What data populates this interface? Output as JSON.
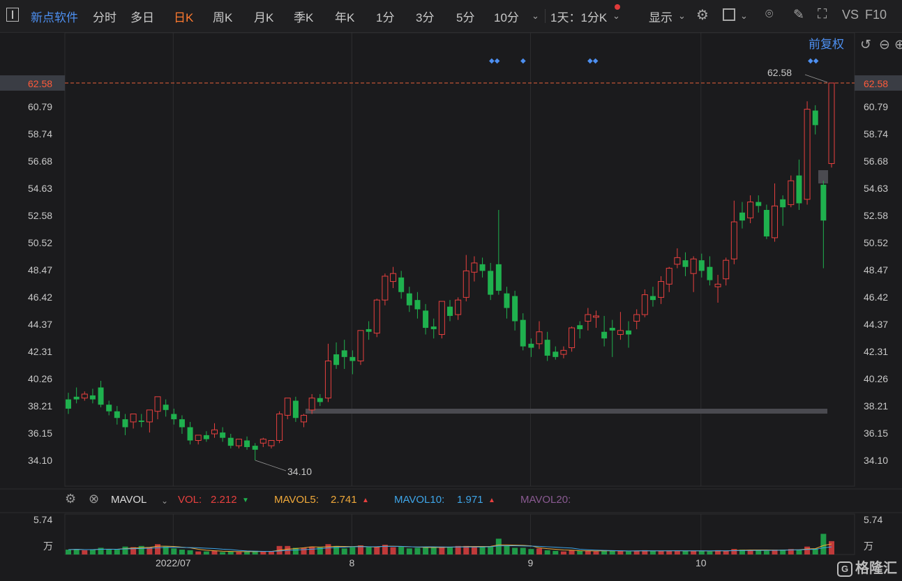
{
  "toolbar": {
    "stock_name": "新点软件",
    "periods": [
      "分时",
      "多日",
      "日K",
      "周K",
      "月K",
      "季K",
      "年K",
      "1分",
      "3分",
      "5分",
      "10分"
    ],
    "active_period": "日K",
    "interval_select": "1天：1分K",
    "display_label": "显示",
    "vs_label": "VS",
    "f10_label": "F10"
  },
  "chart_header": {
    "adjust_label": "前复权"
  },
  "price_axis": {
    "ticks": [
      "60.79",
      "58.74",
      "56.68",
      "54.63",
      "52.58",
      "50.52",
      "48.47",
      "46.42",
      "44.37",
      "42.31",
      "40.26",
      "38.21",
      "36.15",
      "34.10"
    ],
    "current": "62.58"
  },
  "annotations": {
    "high": "62.58",
    "low": "34.10"
  },
  "volume": {
    "indicator": "MAVOL",
    "vol_label": "VOL:",
    "vol_value": "2.212",
    "mavol5_label": "MAVOL5:",
    "mavol5_value": "2.741",
    "mavol10_label": "MAVOL10:",
    "mavol10_value": "1.971",
    "mavol20_label": "MAVOL20:",
    "axis_max": "5.74",
    "axis_unit": "万"
  },
  "x_axis": {
    "labels": [
      "2022/07",
      "8",
      "9",
      "10"
    ]
  },
  "logo": {
    "text": "格隆汇",
    "mark": "G"
  },
  "colors": {
    "up": "#e8403f",
    "down": "#1fb14e",
    "accent": "#ff7a2f",
    "link": "#4d8ff0",
    "ma5": "#f0a93a",
    "ma10": "#3ea5e8",
    "ma20": "#8a5a92"
  },
  "chart_data": {
    "type": "candlestick",
    "ylim": [
      34.1,
      62.58
    ],
    "candles": [
      [
        38.7,
        39.2,
        38.0,
        37.6,
        "down"
      ],
      [
        38.9,
        39.6,
        38.7,
        38.4,
        "down"
      ],
      [
        38.8,
        39.3,
        39.1,
        38.6,
        "up"
      ],
      [
        39.0,
        39.5,
        38.7,
        38.4,
        "down"
      ],
      [
        39.6,
        40.1,
        38.3,
        38.1,
        "down"
      ],
      [
        38.3,
        38.6,
        37.8,
        37.5,
        "down"
      ],
      [
        37.8,
        38.2,
        37.3,
        36.8,
        "down"
      ],
      [
        37.2,
        37.6,
        36.6,
        36.0,
        "down"
      ],
      [
        37.0,
        37.4,
        37.6,
        36.5,
        "up"
      ],
      [
        37.1,
        37.6,
        37.0,
        36.6,
        "down"
      ],
      [
        37.0,
        37.6,
        37.9,
        36.2,
        "up"
      ],
      [
        37.8,
        38.9,
        38.9,
        37.2,
        "up"
      ],
      [
        38.3,
        38.7,
        37.9,
        37.4,
        "down"
      ],
      [
        37.6,
        38.0,
        37.2,
        36.8,
        "down"
      ],
      [
        37.2,
        37.5,
        36.6,
        36.1,
        "down"
      ],
      [
        36.6,
        37.0,
        35.6,
        35.3,
        "down"
      ],
      [
        35.6,
        36.0,
        36.0,
        35.3,
        "up"
      ],
      [
        36.0,
        36.3,
        35.7,
        35.5,
        "down"
      ],
      [
        36.1,
        36.9,
        36.4,
        35.8,
        "up"
      ],
      [
        36.2,
        36.6,
        35.8,
        35.5,
        "down"
      ],
      [
        35.8,
        36.1,
        35.2,
        35.0,
        "down"
      ],
      [
        35.2,
        35.7,
        35.7,
        35.0,
        "up"
      ],
      [
        35.6,
        35.9,
        35.1,
        34.9,
        "down"
      ],
      [
        35.2,
        35.4,
        34.9,
        34.1,
        "down"
      ],
      [
        35.4,
        35.8,
        35.7,
        35.1,
        "up"
      ],
      [
        35.2,
        35.5,
        35.6,
        35.0,
        "up"
      ],
      [
        35.6,
        37.8,
        37.6,
        35.4,
        "up"
      ],
      [
        37.5,
        38.8,
        38.8,
        37.2,
        "up"
      ],
      [
        38.6,
        38.9,
        37.3,
        37.0,
        "down"
      ],
      [
        37.0,
        37.6,
        37.5,
        36.6,
        "up"
      ],
      [
        37.9,
        39.1,
        38.8,
        37.6,
        "up"
      ],
      [
        38.5,
        39.1,
        38.8,
        38.2,
        "down"
      ],
      [
        38.8,
        42.9,
        41.6,
        38.5,
        "up"
      ],
      [
        42.1,
        43.0,
        41.3,
        41.0,
        "down"
      ],
      [
        42.4,
        43.2,
        41.9,
        41.0,
        "down"
      ],
      [
        41.9,
        42.4,
        41.6,
        40.6,
        "down"
      ],
      [
        41.6,
        43.4,
        43.9,
        41.3,
        "up"
      ],
      [
        44.0,
        44.6,
        43.8,
        43.2,
        "down"
      ],
      [
        43.7,
        46.3,
        46.2,
        43.4,
        "up"
      ],
      [
        46.2,
        48.2,
        48.0,
        45.8,
        "up"
      ],
      [
        48.2,
        48.7,
        47.6,
        47.1,
        "up"
      ],
      [
        47.9,
        48.4,
        46.8,
        46.3,
        "down"
      ],
      [
        46.7,
        47.2,
        45.8,
        45.3,
        "down"
      ],
      [
        46.2,
        46.8,
        45.5,
        44.8,
        "down"
      ],
      [
        45.4,
        45.9,
        44.1,
        43.6,
        "down"
      ],
      [
        44.2,
        44.8,
        44.0,
        43.3,
        "down"
      ],
      [
        43.6,
        46.1,
        46.1,
        43.3,
        "up"
      ],
      [
        45.7,
        46.2,
        45.0,
        44.6,
        "down"
      ],
      [
        45.1,
        46.4,
        46.2,
        44.7,
        "up"
      ],
      [
        46.4,
        49.6,
        48.4,
        46.1,
        "up"
      ],
      [
        48.3,
        49.5,
        49.0,
        47.6,
        "up"
      ],
      [
        48.9,
        49.4,
        48.4,
        47.9,
        "down"
      ],
      [
        48.4,
        49.0,
        46.6,
        46.2,
        "down"
      ],
      [
        48.9,
        53.0,
        46.9,
        46.6,
        "down"
      ],
      [
        46.7,
        47.2,
        45.6,
        44.8,
        "down"
      ],
      [
        46.5,
        46.9,
        44.6,
        43.9,
        "down"
      ],
      [
        44.7,
        45.2,
        42.7,
        42.4,
        "down"
      ],
      [
        42.9,
        43.3,
        42.6,
        41.9,
        "down"
      ],
      [
        42.9,
        44.6,
        43.8,
        42.5,
        "up"
      ],
      [
        43.2,
        43.8,
        42.0,
        41.6,
        "down"
      ],
      [
        42.3,
        42.7,
        41.9,
        41.7,
        "down"
      ],
      [
        42.1,
        42.7,
        42.4,
        41.8,
        "up"
      ],
      [
        42.6,
        44.2,
        44.1,
        42.3,
        "up"
      ],
      [
        44.0,
        44.6,
        44.3,
        43.3,
        "down"
      ],
      [
        44.6,
        45.6,
        45.1,
        43.9,
        "up"
      ],
      [
        45.0,
        45.4,
        44.9,
        44.1,
        "up"
      ],
      [
        43.8,
        45.0,
        43.3,
        42.7,
        "down"
      ],
      [
        44.1,
        44.7,
        43.9,
        41.9,
        "down"
      ],
      [
        43.6,
        45.3,
        43.9,
        43.2,
        "up"
      ],
      [
        43.9,
        44.6,
        43.6,
        42.6,
        "down"
      ],
      [
        44.6,
        45.5,
        45.1,
        44.0,
        "up"
      ],
      [
        45.1,
        47.0,
        46.6,
        44.9,
        "up"
      ],
      [
        46.5,
        47.2,
        46.2,
        45.7,
        "down"
      ],
      [
        46.4,
        48.0,
        47.6,
        45.9,
        "up"
      ],
      [
        47.4,
        48.7,
        48.6,
        46.8,
        "up"
      ],
      [
        48.9,
        50.1,
        49.4,
        48.6,
        "up"
      ],
      [
        49.2,
        49.8,
        48.7,
        48.0,
        "down"
      ],
      [
        48.2,
        49.5,
        49.3,
        46.8,
        "up"
      ],
      [
        49.2,
        49.7,
        48.4,
        47.9,
        "down"
      ],
      [
        48.7,
        49.5,
        47.7,
        47.3,
        "down"
      ],
      [
        47.4,
        48.1,
        47.2,
        46.0,
        "up"
      ],
      [
        47.8,
        49.4,
        49.2,
        47.3,
        "up"
      ],
      [
        49.3,
        53.7,
        52.1,
        48.9,
        "up"
      ],
      [
        52.2,
        53.6,
        52.8,
        51.6,
        "down"
      ],
      [
        52.4,
        54.1,
        53.6,
        52.0,
        "up"
      ],
      [
        53.6,
        54.1,
        53.3,
        52.8,
        "down"
      ],
      [
        53.0,
        53.4,
        51.0,
        50.8,
        "down"
      ],
      [
        50.9,
        55.0,
        53.3,
        50.6,
        "up"
      ],
      [
        53.8,
        54.1,
        53.2,
        51.8,
        "down"
      ],
      [
        53.4,
        55.6,
        55.2,
        53.2,
        "up"
      ],
      [
        55.6,
        56.8,
        53.5,
        53.0,
        "down"
      ],
      [
        53.8,
        61.2,
        60.6,
        53.4,
        "up"
      ],
      [
        60.5,
        60.9,
        59.4,
        58.7,
        "down"
      ],
      [
        54.9,
        55.2,
        52.2,
        48.6,
        "down"
      ],
      [
        56.5,
        62.58,
        62.58,
        56.2,
        "up"
      ]
    ],
    "volume_series": {
      "ylim": [
        0,
        5.74
      ],
      "values": [
        0.8,
        0.9,
        0.7,
        0.8,
        1.1,
        0.9,
        0.8,
        1.3,
        1.2,
        1.4,
        1.2,
        1.7,
        1.3,
        1.0,
        0.8,
        0.7,
        0.5,
        0.5,
        0.6,
        0.4,
        0.5,
        0.4,
        0.5,
        0.6,
        0.5,
        0.5,
        1.4,
        1.4,
        1.1,
        1.1,
        1.3,
        1.2,
        1.7,
        1.4,
        1.0,
        1.2,
        1.5,
        1.2,
        1.3,
        1.6,
        1.2,
        1.3,
        1.0,
        1.1,
        1.2,
        1.2,
        1.3,
        1.2,
        1.4,
        1.4,
        1.3,
        1.3,
        1.3,
        2.6,
        1.4,
        1.1,
        1.1,
        0.9,
        1.0,
        0.7,
        0.6,
        0.5,
        0.7,
        0.6,
        0.6,
        0.5,
        0.7,
        0.6,
        0.6,
        0.5,
        0.6,
        0.7,
        0.6,
        0.6,
        0.6,
        0.6,
        0.6,
        0.6,
        0.6,
        0.5,
        0.7,
        0.6,
        0.9,
        0.8,
        0.7,
        0.7,
        0.6,
        0.8,
        0.8,
        0.9,
        0.8,
        1.3,
        1.0,
        3.4,
        2.2
      ]
    },
    "x_axis_labels": [
      {
        "text": "2022/07",
        "index": 13
      },
      {
        "text": "8",
        "index": 35
      },
      {
        "text": "9",
        "index": 57
      },
      {
        "text": "10",
        "index": 78
      }
    ]
  }
}
